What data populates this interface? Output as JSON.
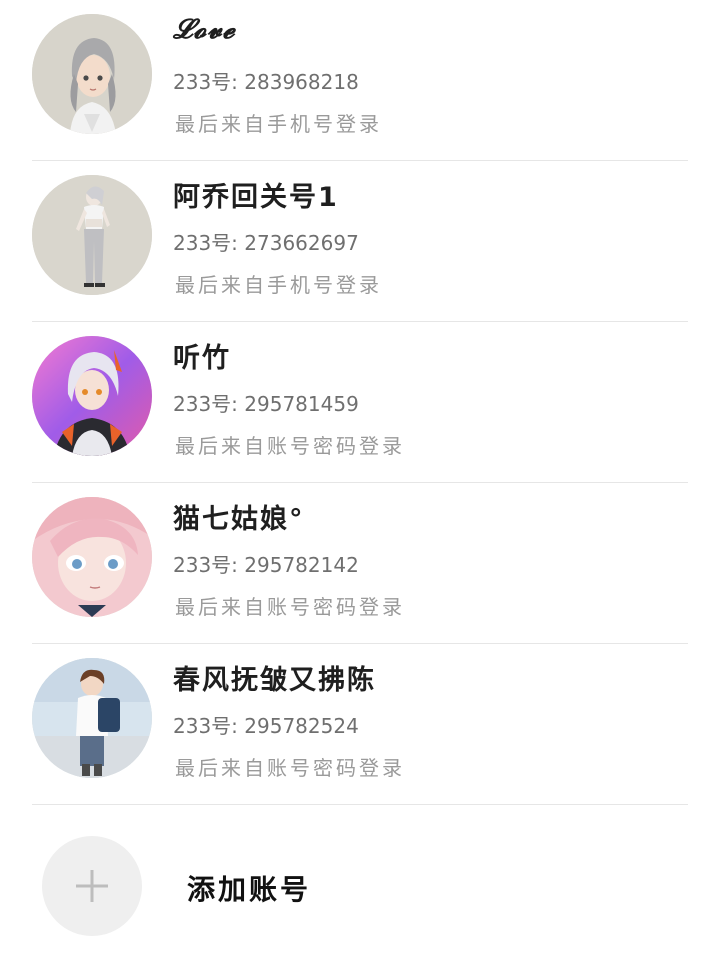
{
  "accounts": [
    {
      "name": "𝓛𝓸𝓿𝓮",
      "uid": "233号: 283968218",
      "login": "最后来自手机号登录",
      "avatar_icon": "anime-girl-silver-hair-avatar"
    },
    {
      "name": "阿乔回关号1",
      "uid": "233号: 273662697",
      "login": "最后来自手机号登录",
      "avatar_icon": "anime-full-body-avatar"
    },
    {
      "name": "听竹",
      "uid": "233号: 295781459",
      "login": "最后来自账号密码登录",
      "avatar_icon": "anime-white-hair-armor-avatar"
    },
    {
      "name": "猫七姑娘°",
      "uid": "233号: 295782142",
      "login": "最后来自账号密码登录",
      "avatar_icon": "anime-pink-hair-avatar"
    },
    {
      "name": "春风抚皱又拂陈",
      "uid": "233号: 295782524",
      "login": "最后来自账号密码登录",
      "avatar_icon": "anime-boy-backpack-avatar"
    }
  ],
  "add_account": {
    "label": "添加账号",
    "icon": "plus-icon"
  },
  "colors": {
    "divider": "#e6e6e6",
    "name": "#1f1f1f",
    "uid": "#6f6f6f",
    "login": "#9a9a9a",
    "add_circle": "#efefef"
  }
}
